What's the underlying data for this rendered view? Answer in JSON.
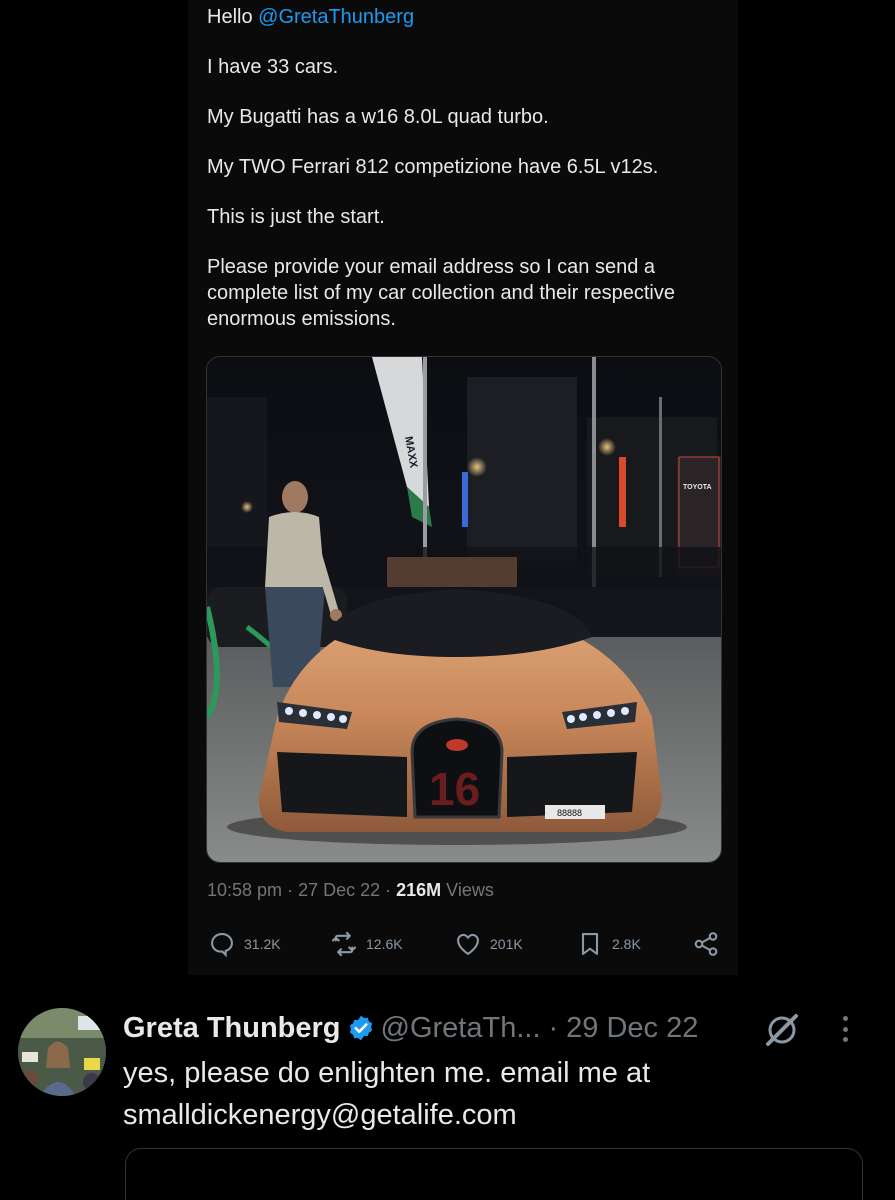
{
  "quoted_tweet": {
    "greeting": "Hello",
    "mention": "@GretaThunberg",
    "paragraphs": [
      "I have 33 cars.",
      "My Bugatti has a w16 8.0L quad turbo.",
      "My TWO Ferrari 812 competizione have 6.5L v12s.",
      "This is just the start.",
      "Please provide your email address so I can send a complete list of my car collection and their respective enormous emissions."
    ],
    "media": {
      "flag_text": "MAXX",
      "sign_text": "TOYOTA",
      "grille_number": "16",
      "plate_text": "88888"
    },
    "time": "10:58 pm",
    "sep1": " · ",
    "date": "27 Dec 22",
    "sep2": " · ",
    "views_count": "216M",
    "views_label": " Views",
    "actions": {
      "replies": "31.2K",
      "retweets": "12.6K",
      "likes": "201K",
      "bookmarks": "2.8K"
    }
  },
  "reply": {
    "name": "Greta Thunberg",
    "handle": "@GretaTh...",
    "dot": "·",
    "date": "29 Dec 22",
    "text_line1": "yes, please do enlighten me. email me at",
    "text_line2": "smalldickenergy@getalife.com"
  },
  "colors": {
    "background": "#000000",
    "text": "#e7e9ea",
    "muted": "#71767b",
    "link": "#1d9bf0",
    "verified": "#1d9bf0"
  }
}
